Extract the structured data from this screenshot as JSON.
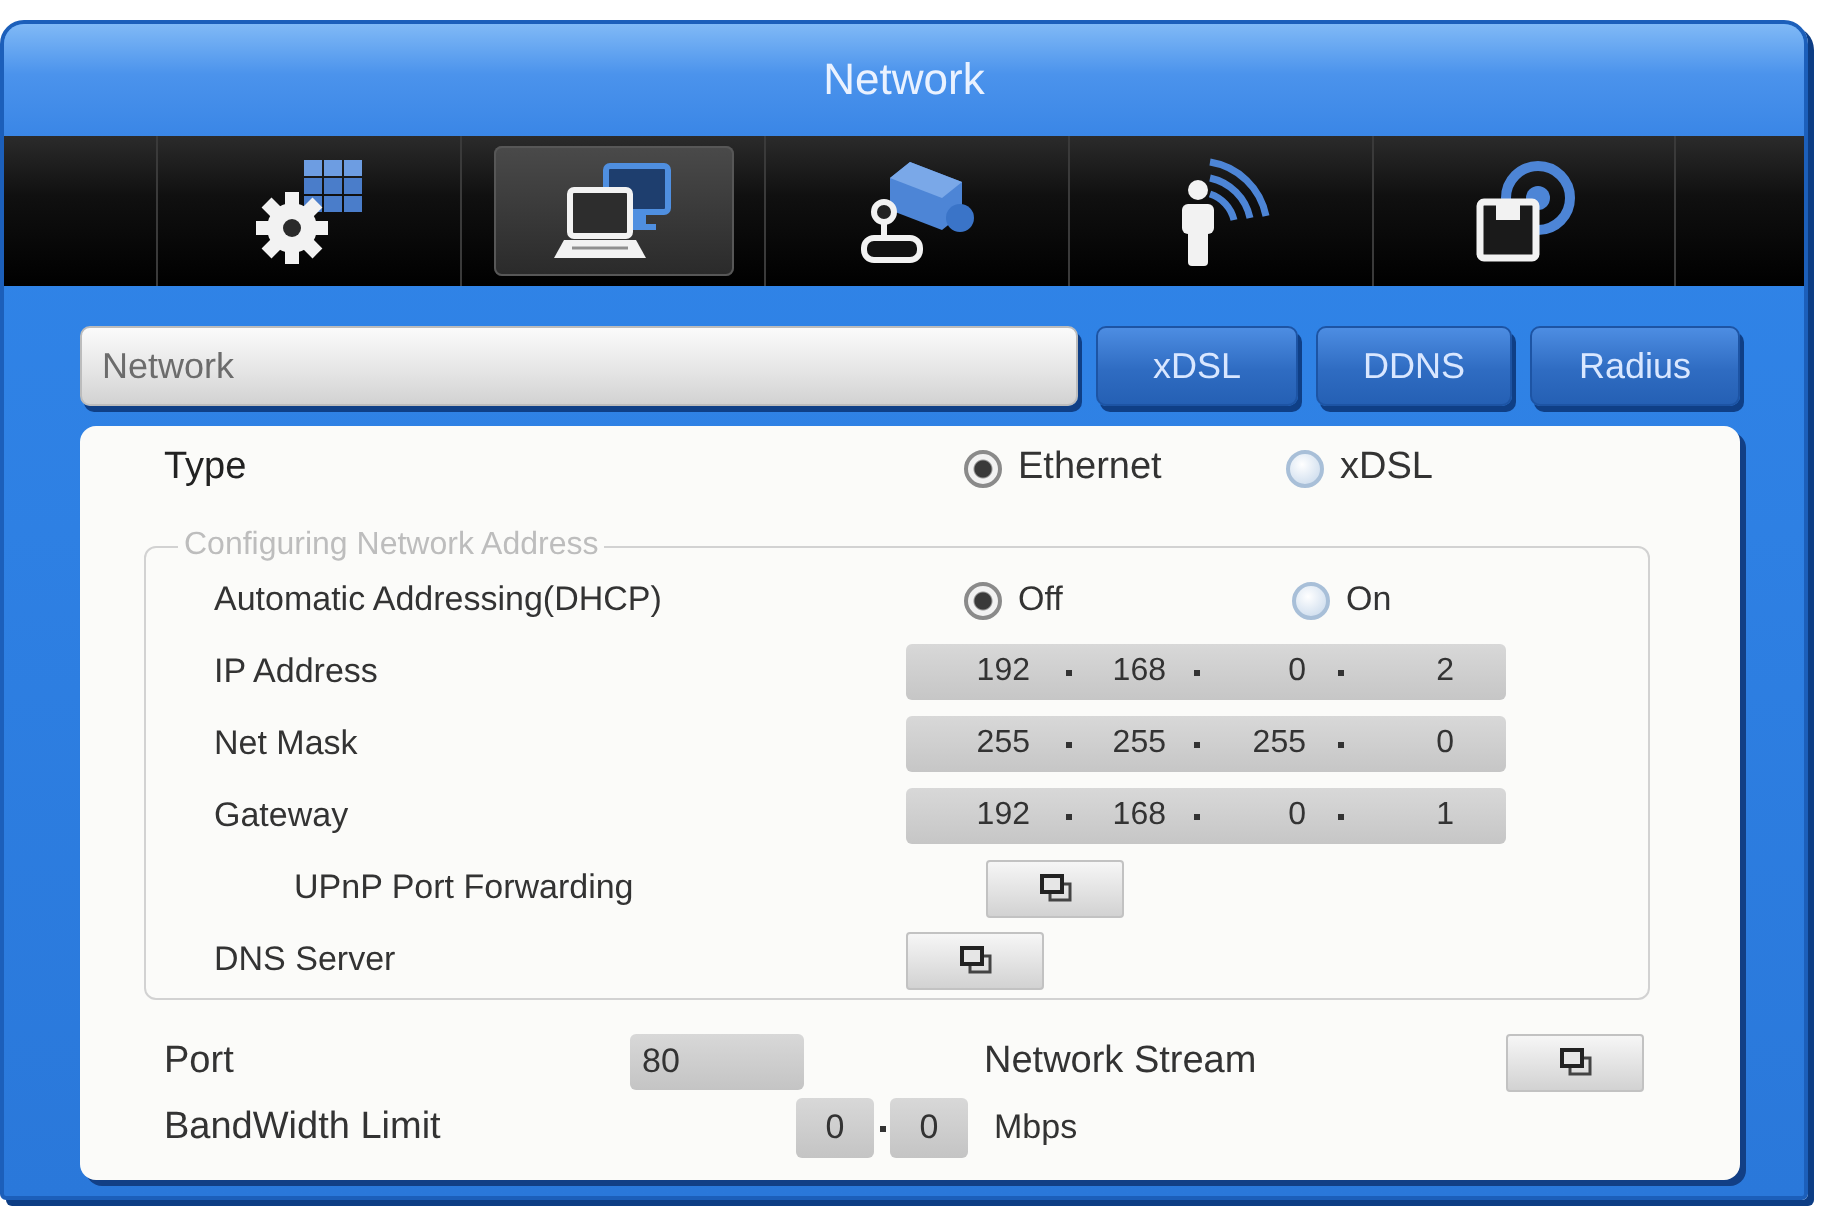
{
  "window": {
    "title": "Network"
  },
  "toolbar": {
    "items": [
      {
        "selected": false
      },
      {
        "selected": true
      },
      {
        "selected": false
      },
      {
        "selected": false
      },
      {
        "selected": false
      }
    ]
  },
  "tabs": [
    {
      "label": "Network",
      "selected": true
    },
    {
      "label": "xDSL",
      "selected": false
    },
    {
      "label": "DDNS",
      "selected": false
    },
    {
      "label": "Radius",
      "selected": false
    }
  ],
  "type": {
    "label": "Type",
    "options": [
      {
        "label": "Ethernet",
        "selected": true
      },
      {
        "label": "xDSL",
        "selected": false
      }
    ]
  },
  "address_group": {
    "legend": "Configuring Network Address",
    "dhcp": {
      "label": "Automatic Addressing(DHCP)",
      "options": [
        {
          "label": "Off",
          "selected": true
        },
        {
          "label": "On",
          "selected": false
        }
      ]
    },
    "addresses": [
      {
        "label": "IP Address",
        "octets": [
          "192",
          "168",
          "0",
          "2"
        ]
      },
      {
        "label": "Net Mask",
        "octets": [
          "255",
          "255",
          "255",
          "0"
        ]
      },
      {
        "label": "Gateway",
        "octets": [
          "192",
          "168",
          "0",
          "1"
        ]
      }
    ],
    "upnp": {
      "label": "UPnP Port Forwarding"
    },
    "dns": {
      "label": "DNS Server"
    }
  },
  "port": {
    "label": "Port",
    "value": "80"
  },
  "network_stream": {
    "label": "Network Stream"
  },
  "bandwidth": {
    "label": "BandWidth Limit",
    "values": [
      "0",
      "0"
    ],
    "unit": "Mbps"
  }
}
